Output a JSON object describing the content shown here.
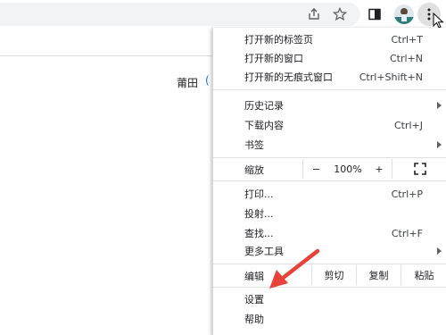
{
  "toolbar": {
    "share_icon": "share-icon",
    "bookmark_icon": "star-icon",
    "sidepanel_icon": "side-panel-icon",
    "menu_icon": "kebab-menu-icon"
  },
  "page": {
    "location_text": "莆田",
    "partial_glyph": "("
  },
  "menu": {
    "new_tab": {
      "label": "打开新的标签页",
      "shortcut": "Ctrl+T"
    },
    "new_window": {
      "label": "打开新的窗口",
      "shortcut": "Ctrl+N"
    },
    "incognito": {
      "label": "打开新的无痕式窗口",
      "shortcut": "Ctrl+Shift+N"
    },
    "history": {
      "label": "历史记录"
    },
    "downloads": {
      "label": "下载内容",
      "shortcut": "Ctrl+J"
    },
    "bookmarks": {
      "label": "书签"
    },
    "zoom": {
      "label": "缩放",
      "minus": "−",
      "value": "100%",
      "plus": "+"
    },
    "print": {
      "label": "打印...",
      "shortcut": "Ctrl+P"
    },
    "cast": {
      "label": "投射..."
    },
    "find": {
      "label": "查找...",
      "shortcut": "Ctrl+F"
    },
    "more_tools": {
      "label": "更多工具"
    },
    "edit": {
      "label": "编辑",
      "cut": "剪切",
      "copy": "复制",
      "paste": "粘贴"
    },
    "settings": {
      "label": "设置"
    },
    "help": {
      "label": "帮助"
    }
  },
  "colors": {
    "annotation_arrow": "#e8433a",
    "menu_separator": "#e0e0e0",
    "omnibox_bg": "#f1f3f4"
  }
}
